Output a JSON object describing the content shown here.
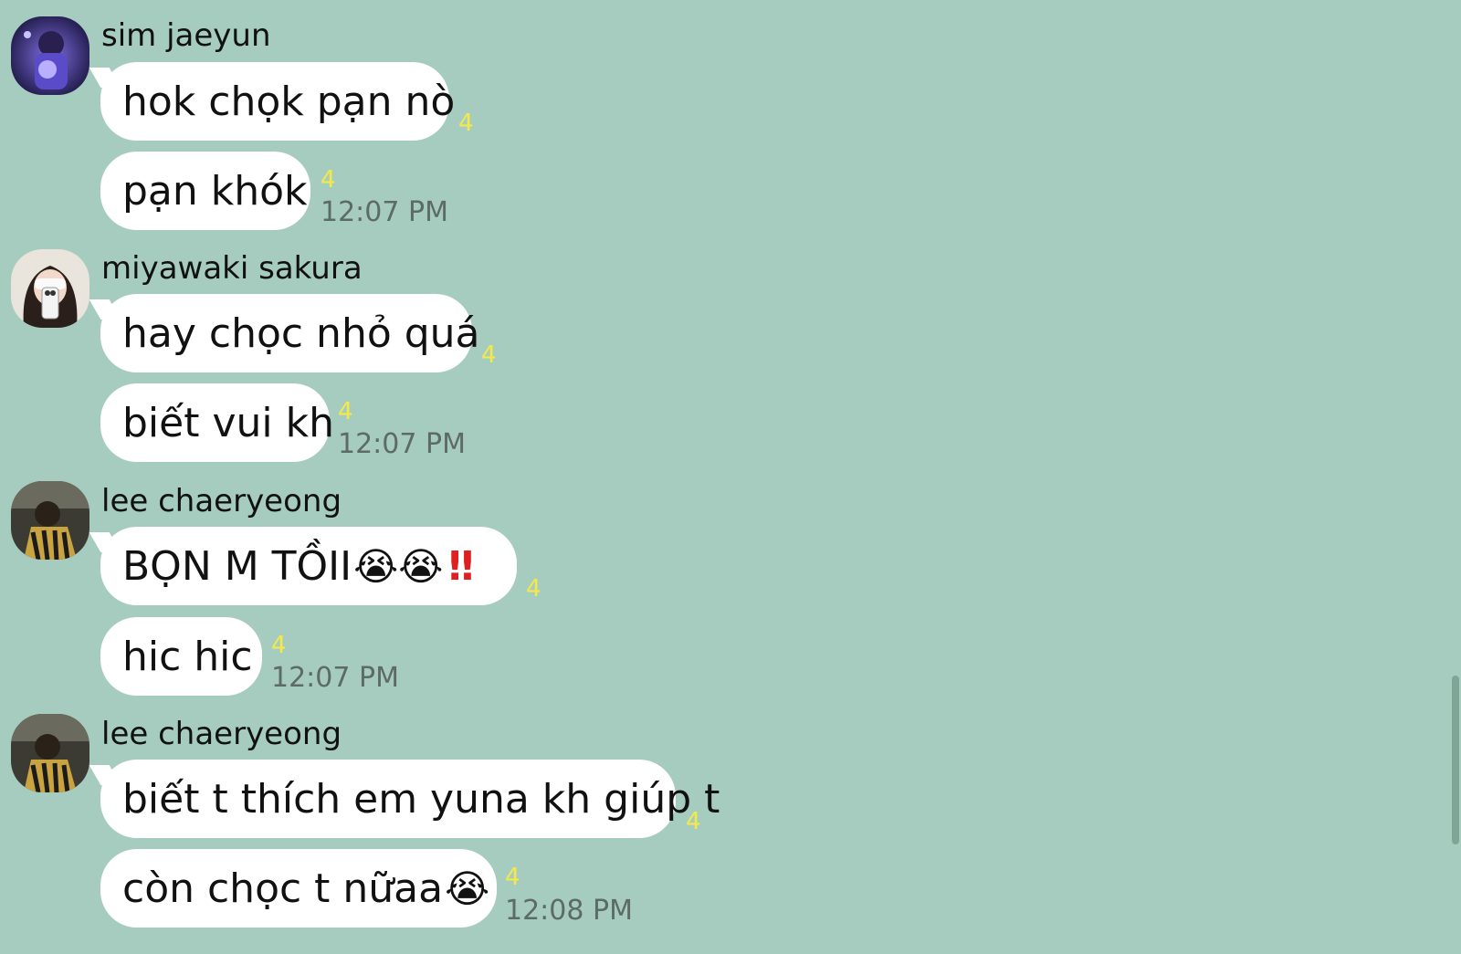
{
  "messages": [
    {
      "sender": "sim jaeyun",
      "avatar": "avatar-photo-sim-jaeyun",
      "lines": [
        {
          "text": "hok chọk pạn nò",
          "read": "4"
        },
        {
          "text": "pạn khók",
          "read": "4",
          "time": "12:07 PM"
        }
      ]
    },
    {
      "sender": "miyawaki sakura",
      "avatar": "avatar-photo-miyawaki-sakura",
      "lines": [
        {
          "text": "hay chọc nhỏ quá",
          "read": "4"
        },
        {
          "text": "biết vui kh",
          "read": "4",
          "time": "12:07 PM"
        }
      ]
    },
    {
      "sender": "lee chaeryeong",
      "avatar": "avatar-photo-lee-chaeryeong",
      "lines": [
        {
          "text": "BỌN M TỒII",
          "emoji": "😭😭",
          "suffix": "‼",
          "read": "4"
        },
        {
          "text": "hic hic",
          "read": "4",
          "time": "12:07 PM"
        }
      ]
    },
    {
      "sender": "lee chaeryeong",
      "avatar": "avatar-photo-lee-chaeryeong",
      "lines": [
        {
          "text": "biết t thích em yuna kh giúp t",
          "read": "4"
        },
        {
          "text": "còn chọc t nữaa",
          "emoji": "😭",
          "read": "4",
          "time": "12:08 PM"
        }
      ]
    }
  ],
  "colors": {
    "background": "#a6ccbf",
    "bubble": "#ffffff",
    "read_count": "#f5e94a",
    "timestamp": "#5c6b66"
  }
}
